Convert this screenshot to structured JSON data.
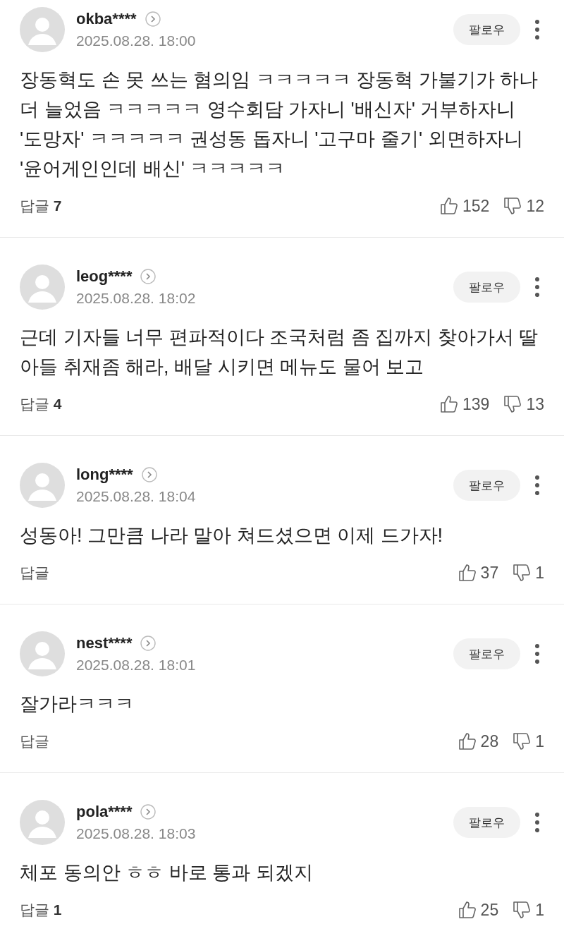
{
  "comments": [
    {
      "username": "okba****",
      "date": "2025.08.28. 18:00",
      "follow_label": "팔로우",
      "body": "장동혁도 손 못 쓰는 혐의임 ㅋㅋㅋㅋㅋ 장동혁 가불기가 하나 더 늘었음 ㅋㅋㅋㅋㅋ 영수회담 가자니 '배신자' 거부하자니 '도망자' ㅋㅋㅋㅋㅋ 권성동 돕자니 '고구마 줄기' 외면하자니 '윤어게인인데 배신' ㅋㅋㅋㅋㅋ",
      "reply_label": "답글",
      "reply_count": "7",
      "likes": "152",
      "dislikes": "12"
    },
    {
      "username": "leog****",
      "date": "2025.08.28. 18:02",
      "follow_label": "팔로우",
      "body": "근데 기자들 너무 편파적이다 조국처럼 좀 집까지 찾아가서 딸 아들 취재좀 해라, 배달 시키면 메뉴도 물어 보고",
      "reply_label": "답글",
      "reply_count": "4",
      "likes": "139",
      "dislikes": "13"
    },
    {
      "username": "long****",
      "date": "2025.08.28. 18:04",
      "follow_label": "팔로우",
      "body": "성동아! 그만큼 나라 말아 쳐드셨으면 이제 드가자!",
      "reply_label": "답글",
      "likes": "37",
      "dislikes": "1"
    },
    {
      "username": "nest****",
      "date": "2025.08.28. 18:01",
      "follow_label": "팔로우",
      "body": "잘가라ㅋㅋㅋ",
      "reply_label": "답글",
      "likes": "28",
      "dislikes": "1"
    },
    {
      "username": "pola****",
      "date": "2025.08.28. 18:03",
      "follow_label": "팔로우",
      "body": "체포 동의안 ㅎㅎ 바로 통과 되겠지",
      "reply_label": "답글",
      "reply_count": "1",
      "likes": "25",
      "dislikes": "1"
    }
  ]
}
